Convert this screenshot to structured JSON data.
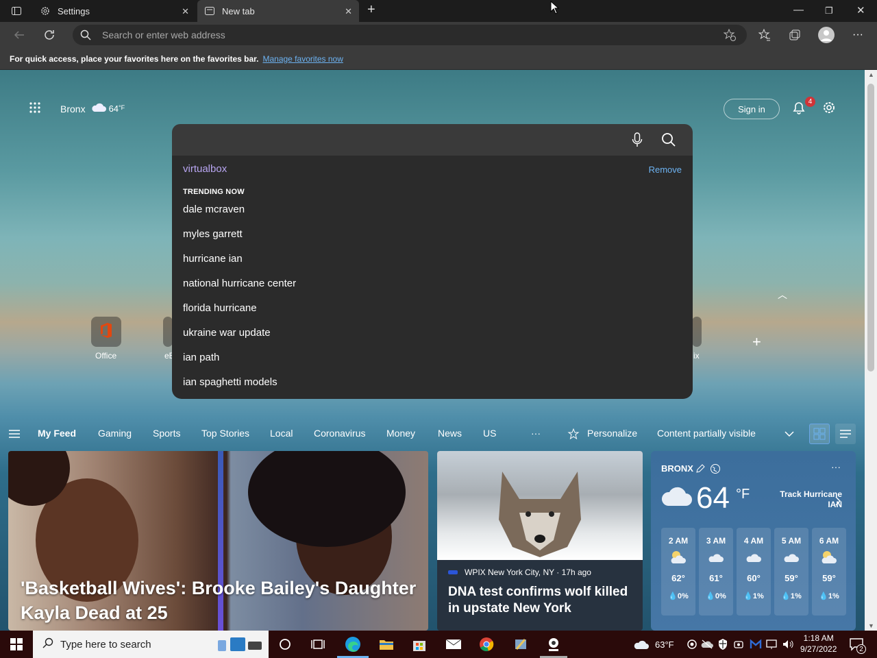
{
  "tabs": [
    {
      "label": "Settings",
      "icon": "gear-icon"
    },
    {
      "label": "New tab",
      "icon": "newtab-icon"
    }
  ],
  "address": {
    "placeholder": "Search or enter web address"
  },
  "favbar": {
    "text": "For quick access, place your favorites here on the favorites bar.",
    "link": "Manage favorites now"
  },
  "header": {
    "location": "Bronx",
    "temp": "64",
    "unit": "°F",
    "sign_in": "Sign in",
    "notifications": "4"
  },
  "search": {
    "recent": "virtualbox",
    "remove_label": "Remove",
    "trending_heading": "TRENDING NOW",
    "suggestions": [
      "dale mcraven",
      "myles garrett",
      "hurricane ian",
      "national hurricane center",
      "florida hurricane",
      "ukraine war update",
      "ian path",
      "ian spaghetti models"
    ]
  },
  "quicklinks": {
    "office": "Office",
    "partial_left": "eE",
    "partial_right": "ix"
  },
  "feed": {
    "tabs": [
      "My Feed",
      "Gaming",
      "Sports",
      "Top Stories",
      "Local",
      "Coronavirus",
      "Money",
      "News",
      "US"
    ],
    "more": "···",
    "personalize": "Personalize",
    "visibility": "Content partially visible"
  },
  "cards": {
    "main_title": "'Basketball Wives': Brooke Bailey's Daughter Kayla Dead at 25",
    "second_source": "WPIX New York City, NY · 17h ago",
    "second_title": "DNA test confirms wolf killed in upstate New York"
  },
  "weather": {
    "location": "BRONX",
    "temp": "64",
    "unit": "°F",
    "track": "Track Hurricane IAN",
    "hours": [
      {
        "time": "2 AM",
        "temp": "62°",
        "precip": "0%",
        "icon": "moon-cloud-icon"
      },
      {
        "time": "3 AM",
        "temp": "61°",
        "precip": "0%",
        "icon": "cloud-icon"
      },
      {
        "time": "4 AM",
        "temp": "60°",
        "precip": "1%",
        "icon": "cloud-icon"
      },
      {
        "time": "5 AM",
        "temp": "59°",
        "precip": "1%",
        "icon": "cloud-icon"
      },
      {
        "time": "6 AM",
        "temp": "59°",
        "precip": "1%",
        "icon": "moon-cloud-icon"
      }
    ]
  },
  "taskbar": {
    "search_placeholder": "Type here to search",
    "temp": "63°F",
    "time": "1:18 AM",
    "date": "9/27/2022",
    "action_badge": "2"
  }
}
